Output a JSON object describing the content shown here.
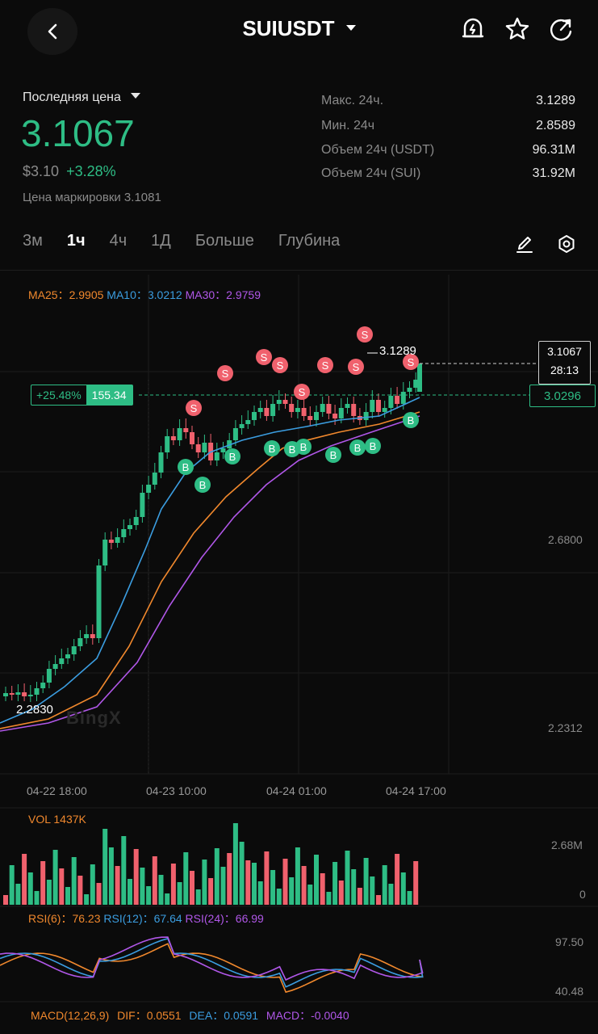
{
  "header": {
    "title": "SUIUSDT"
  },
  "price": {
    "label": "Последняя цена",
    "last": "3.1067",
    "usd": "$3.10",
    "change": "+3.28%",
    "mark": "Цена маркировки 3.1081"
  },
  "stats": [
    {
      "k": "Макс. 24ч.",
      "v": "3.1289"
    },
    {
      "k": "Мин. 24ч",
      "v": "2.8589"
    },
    {
      "k": "Объем 24ч (USDT)",
      "v": "96.31M"
    },
    {
      "k": "Объем 24ч (SUI)",
      "v": "31.92M"
    }
  ],
  "tabs": [
    "3м",
    "1ч",
    "4ч",
    "1Д",
    "Больше",
    "Глубина"
  ],
  "active_tab": "1ч",
  "chart": {
    "ma25": "MA25：2.9905",
    "ma10": "MA10：3.0212",
    "ma30": "MA30：2.9759",
    "high_label": "3.1289",
    "low_label": "2.2830",
    "current_price": "3.1067",
    "countdown": "28:13",
    "avg_price": "3.0296",
    "pnl_pct": "+25.48%",
    "position": "155.34",
    "axis": [
      "2.6800",
      "2.2312"
    ],
    "times": [
      "04-22 18:00",
      "04-23 10:00",
      "04-24 01:00",
      "04-24 17:00"
    ],
    "watermark": "BingX",
    "vol_label": "VOL 1437K",
    "vol_axis": [
      "2.68M",
      "0"
    ],
    "rsi6": "RSI(6)：76.23",
    "rsi12": "RSI(12)：67.64",
    "rsi24": "RSI(24)：66.99",
    "rsi_axis": [
      "97.50",
      "40.48"
    ],
    "macd": "MACD(12,26,9)",
    "dif": "DIF：0.0551",
    "dea": "DEA：0.0591",
    "macd_val": "MACD：-0.0040"
  },
  "colors": {
    "up": "#2ebd85",
    "down": "#f0616d",
    "ma25": "#f0882d",
    "ma10": "#3b9de0",
    "ma30": "#b057e8"
  }
}
